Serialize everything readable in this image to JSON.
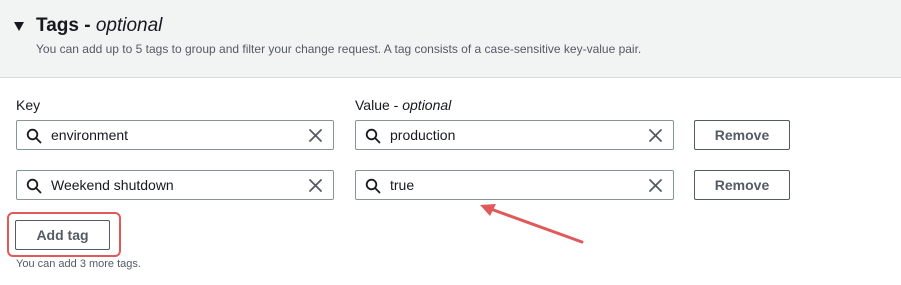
{
  "section": {
    "title": "Tags",
    "title_suffix": "optional",
    "description": "You can add up to 5 tags to group and filter your change request. A tag consists of a case-sensitive key-value pair."
  },
  "columns": {
    "key_label": "Key",
    "value_label": "Value",
    "value_suffix": "optional"
  },
  "tags": [
    {
      "key": "environment",
      "value": "production",
      "remove_label": "Remove"
    },
    {
      "key": "Weekend shutdown",
      "value": "true",
      "remove_label": "Remove"
    }
  ],
  "add_tag_label": "Add tag",
  "remaining_note": "You can add 3 more tags.",
  "colors": {
    "annotation": "#e05a5a",
    "panel_bg": "#f2f3f3",
    "border": "#879596"
  },
  "icons": {
    "section": "caret-down-icon",
    "field_search": "search-icon",
    "field_clear": "close-icon",
    "annotation": "arrow-annotation"
  }
}
